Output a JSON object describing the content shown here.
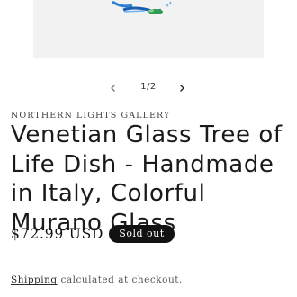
{
  "gallery": {
    "counter": "1/2",
    "prev_icon": "chevron-left-icon",
    "next_icon": "chevron-right-icon"
  },
  "product": {
    "vendor": "NORTHERN LIGHTS GALLERY",
    "title": "Venetian Glass Tree of Life Dish - Handmade in Italy, Colorful Murano Glass",
    "price": "$72.99 USD",
    "badge": "Sold out",
    "shipping_link": "Shipping",
    "shipping_text": " calculated at checkout."
  },
  "colors": {
    "badge_bg": "#121212",
    "text": "#121212",
    "image_bg": "#f3f3f3"
  }
}
